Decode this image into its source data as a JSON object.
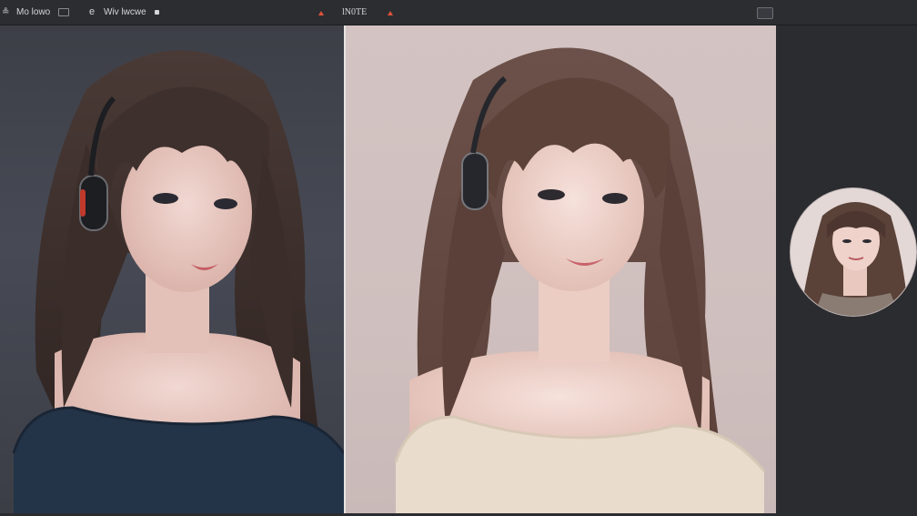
{
  "toolbar": {
    "item_1": "Mo lowo",
    "item_2": "Wiv lwcwe",
    "center_label": "lN0TE"
  },
  "icons": {
    "back": "e-glyph-icon",
    "layout": "panel-box-icon",
    "caret": "caret-up-icon",
    "window": "window-toggle-icon"
  },
  "colors": {
    "accent": "#e0543a",
    "background": "#2a2b2f",
    "toolbar": "#2c2d31"
  }
}
